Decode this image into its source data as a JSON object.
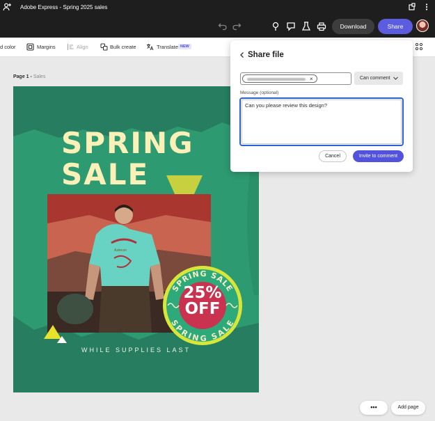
{
  "window": {
    "title": "Adobe Express - Spring 2025 sales",
    "icons": [
      "extensions-icon",
      "kebab-menu-icon"
    ]
  },
  "appbar": {
    "download_label": "Download",
    "share_label": "Share",
    "icons": [
      "undo-icon",
      "redo-icon",
      "add-collaborator-icon",
      "pin-icon",
      "comment-icon",
      "beaker-icon",
      "print-icon",
      "avatar"
    ]
  },
  "toolbar": {
    "items": {
      "color": "d color",
      "margins": "Margins",
      "align": "Align",
      "bulk_create": "Bulk create",
      "translate": "Translate",
      "new_badge": "NEW"
    }
  },
  "page": {
    "number_label": "Page 1 -",
    "name": "Sales"
  },
  "design": {
    "headline_line1": "SPRING",
    "headline_line2": "SALE",
    "seal_top": "SPRING SALE",
    "seal_bottom": "SPRING SALE",
    "seal_percent": "25%",
    "seal_off": "OFF",
    "tagline": "WHILE SUPPLIES LAST",
    "colors": {
      "background": "#2e9a71",
      "dark_shape": "#277d5f",
      "headline": "#fbf0b8",
      "triangle": "#d8d73b",
      "seal_ring": "#2ea97a",
      "seal_center": "#c9334f"
    }
  },
  "share_panel": {
    "title": "Share file",
    "permission": "Can comment",
    "message_label": "Message (optional)",
    "message_value": "Can you please review this design?",
    "cancel_label": "Cancel",
    "invite_label": "Invite to comment"
  },
  "bottom": {
    "more_label": "•••",
    "add_page_label": "Add page"
  }
}
